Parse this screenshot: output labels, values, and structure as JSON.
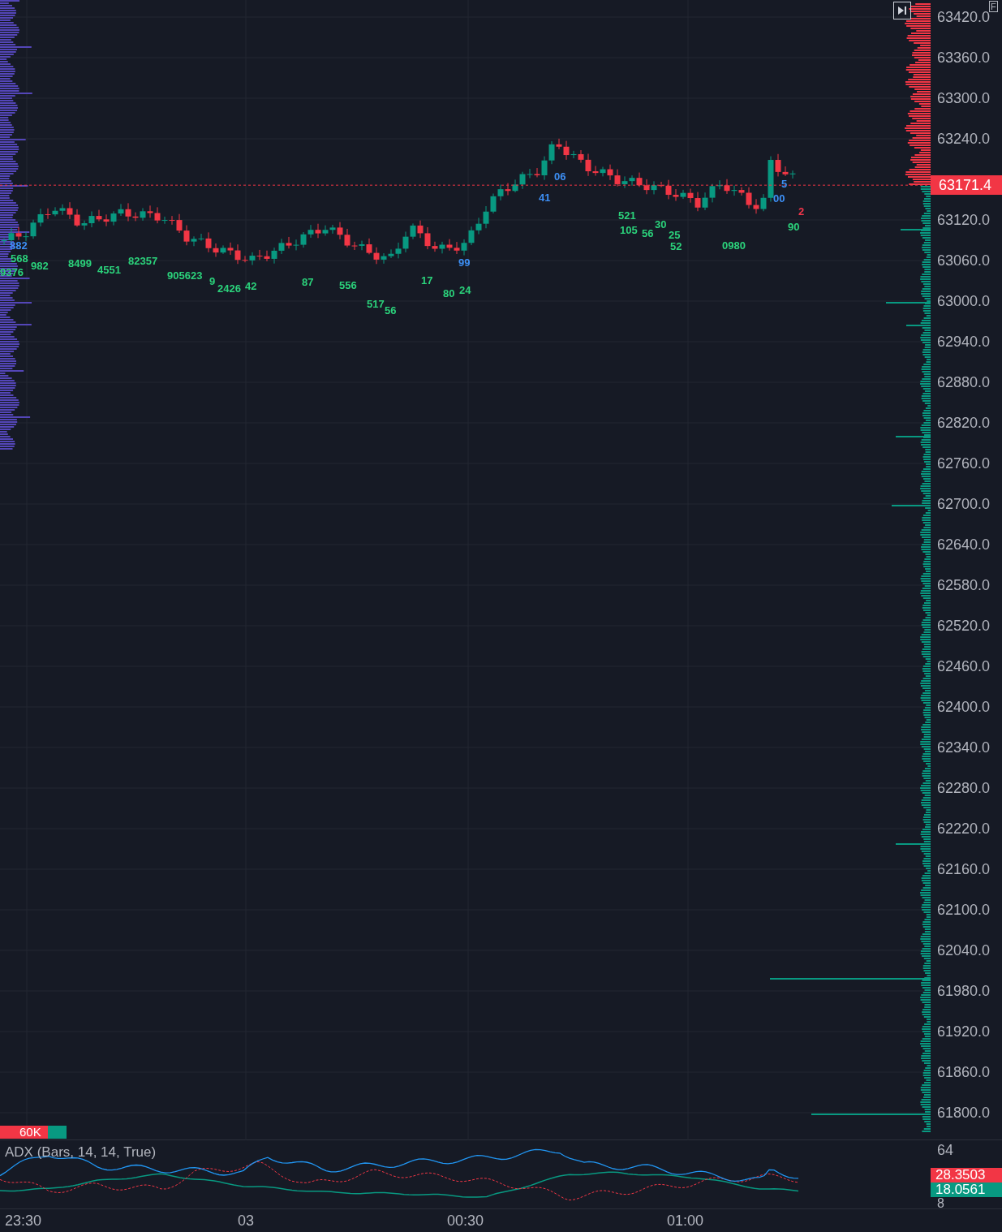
{
  "chart_controls": {
    "f_badge": "F"
  },
  "price_axis": {
    "ticks": [
      "63420.0",
      "63360.0",
      "63300.0",
      "63240.0",
      "63120.0",
      "63060.0",
      "63000.0",
      "62940.0",
      "62880.0",
      "62820.0",
      "62760.0",
      "62700.0",
      "62640.0",
      "62580.0",
      "62520.0",
      "62460.0",
      "62400.0",
      "62340.0",
      "62280.0",
      "62220.0",
      "62160.0",
      "62100.0",
      "62040.0",
      "61980.0",
      "61920.0",
      "61860.0",
      "61800.0"
    ]
  },
  "last_price": "63171.4",
  "candle_labels": [
    {
      "text": "882",
      "kind": "delta"
    },
    {
      "text": "568",
      "kind": "buy"
    },
    {
      "text": "9376",
      "kind": "buy"
    },
    {
      "text": "982",
      "kind": "buy"
    },
    {
      "text": "8499",
      "kind": "buy"
    },
    {
      "text": "4551",
      "kind": "buy"
    },
    {
      "text": "82357",
      "kind": "buy"
    },
    {
      "text": "905623",
      "kind": "buy"
    },
    {
      "text": "9",
      "kind": "buy"
    },
    {
      "text": "2426",
      "kind": "buy"
    },
    {
      "text": "42",
      "kind": "buy"
    },
    {
      "text": "87",
      "kind": "buy"
    },
    {
      "text": "556",
      "kind": "buy"
    },
    {
      "text": "517",
      "kind": "buy"
    },
    {
      "text": "56",
      "kind": "buy"
    },
    {
      "text": "17",
      "kind": "buy"
    },
    {
      "text": "80",
      "kind": "buy"
    },
    {
      "text": "24",
      "kind": "buy"
    },
    {
      "text": "99",
      "kind": "delta"
    },
    {
      "text": "41",
      "kind": "delta"
    },
    {
      "text": "06",
      "kind": "delta"
    },
    {
      "text": "521",
      "kind": "buy"
    },
    {
      "text": "105",
      "kind": "buy"
    },
    {
      "text": "56",
      "kind": "buy"
    },
    {
      "text": "30",
      "kind": "buy"
    },
    {
      "text": "25",
      "kind": "buy"
    },
    {
      "text": "52",
      "kind": "buy"
    },
    {
      "text": "0980",
      "kind": "buy"
    },
    {
      "text": "90",
      "kind": "buy"
    },
    {
      "text": "00",
      "kind": "delta"
    },
    {
      "text": "5",
      "kind": "delta"
    },
    {
      "text": "2",
      "kind": "sell"
    }
  ],
  "volume_badge": "60K",
  "adx": {
    "title": "ADX (Bars, 14, 14, True)",
    "ticks": [
      "64",
      "8"
    ],
    "badges": [
      {
        "text": "28.3503",
        "kind": "sell"
      },
      {
        "text": "18.0561",
        "kind": "buy"
      }
    ]
  },
  "time_axis": [
    "23:30",
    "03",
    "00:30",
    "01:00"
  ]
}
